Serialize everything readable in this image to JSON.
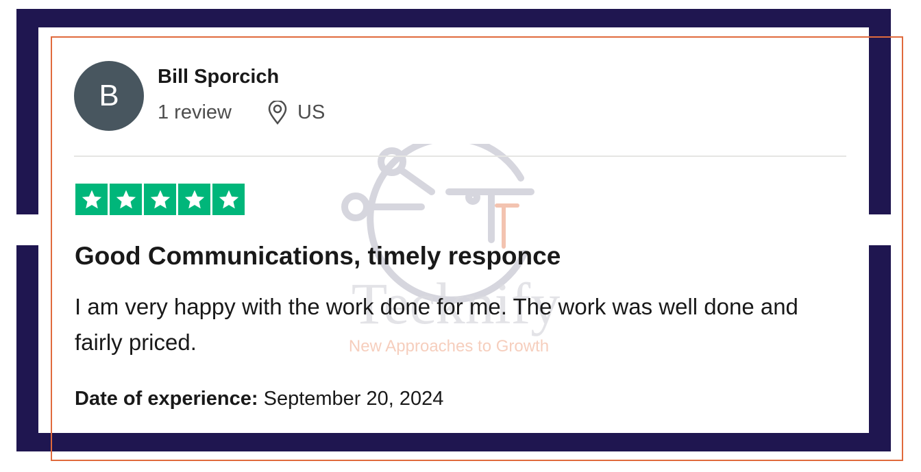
{
  "reviewer": {
    "initial": "B",
    "name": "Bill Sporcich",
    "review_count": "1 review",
    "country": "US"
  },
  "rating": {
    "stars": 5,
    "max_stars": 5
  },
  "review": {
    "title": "Good Communications, timely responce",
    "body": "I am very happy with the work done for me. The work was well done and fairly priced."
  },
  "experience": {
    "label": "Date of experience:",
    "date": "September 20, 2024"
  },
  "watermark": {
    "brand": "Tecknify",
    "tagline": "New Approaches to Growth"
  },
  "colors": {
    "frame": "#1f1650",
    "accent_outline": "#e06a3c",
    "star_green": "#00b67a",
    "avatar_bg": "#48565f"
  }
}
